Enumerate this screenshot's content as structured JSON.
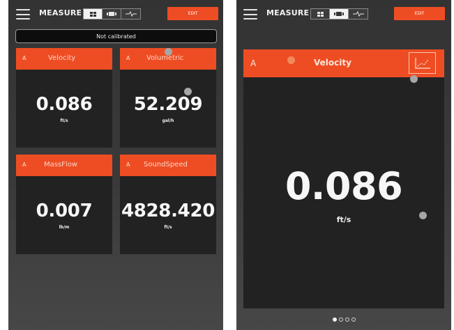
{
  "colors": {
    "accent": "#ee4d23",
    "tile_background": "#222222",
    "screen_background": "#363636",
    "text": "#f7f7f7"
  },
  "left_screen": {
    "header": {
      "menu_icon": "hamburger-menu-icon",
      "title": "MEASURE",
      "view_modes": [
        {
          "icon": "grid-view-icon",
          "selected": true
        },
        {
          "icon": "single-view-icon",
          "selected": false
        },
        {
          "icon": "waveform-view-icon",
          "selected": false
        }
      ],
      "edit_label": "EDIT"
    },
    "status": "Not calibrated",
    "tiles": [
      {
        "channel": "A",
        "name": "Velocity",
        "value": "0.086",
        "unit": "ft/s"
      },
      {
        "channel": "A",
        "name": "Volumetric",
        "value": "52.209",
        "unit": "gal/h"
      },
      {
        "channel": "A",
        "name": "MassFlow",
        "value": "0.007",
        "unit": "lb/m"
      },
      {
        "channel": "A",
        "name": "SoundSpeed",
        "value": "4828.420",
        "unit": "ft/s"
      }
    ]
  },
  "right_screen": {
    "header": {
      "menu_icon": "hamburger-menu-icon",
      "title": "MEASURE",
      "view_modes": [
        {
          "icon": "grid-view-icon",
          "selected": false
        },
        {
          "icon": "single-view-icon",
          "selected": true
        },
        {
          "icon": "waveform-view-icon",
          "selected": false
        }
      ],
      "edit_label": "EDIT"
    },
    "detail": {
      "channel": "A",
      "name": "Velocity",
      "value": "0.086",
      "unit": "ft/s",
      "trend_icon": "trend-chart-icon"
    },
    "pager": {
      "pages": 4,
      "current": 1
    }
  }
}
